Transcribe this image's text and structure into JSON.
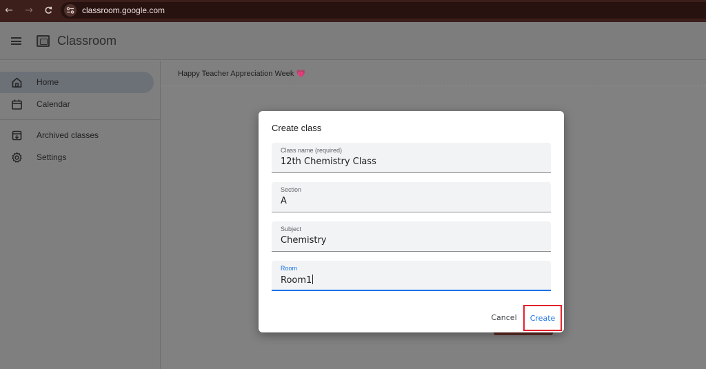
{
  "browser": {
    "url": "classroom.google.com",
    "back_icon": "←",
    "forward_icon": "→",
    "reload_icon": "C"
  },
  "app": {
    "title": "Classroom"
  },
  "sidebar": {
    "items": [
      {
        "label": "Home",
        "icon": "home-icon",
        "active": true
      },
      {
        "label": "Calendar",
        "icon": "calendar-icon",
        "active": false
      },
      {
        "label": "Archived classes",
        "icon": "archive-icon",
        "active": false
      },
      {
        "label": "Settings",
        "icon": "gear-icon",
        "active": false
      }
    ]
  },
  "banner": {
    "text": "Happy Teacher Appreciation Week",
    "emoji": "💗"
  },
  "dialog": {
    "title": "Create class",
    "fields": [
      {
        "label": "Class name (required)",
        "value": "12th Chemistry Class"
      },
      {
        "label": "Section",
        "value": "A"
      },
      {
        "label": "Subject",
        "value": "Chemistry"
      },
      {
        "label": "Room",
        "value": "Room1",
        "focused": true
      }
    ],
    "cancel_label": "Cancel",
    "create_label": "Create"
  },
  "colors": {
    "accent": "#1a73e8",
    "highlight_box": "#e3212b",
    "browser_bar": "#3c1f1b"
  }
}
